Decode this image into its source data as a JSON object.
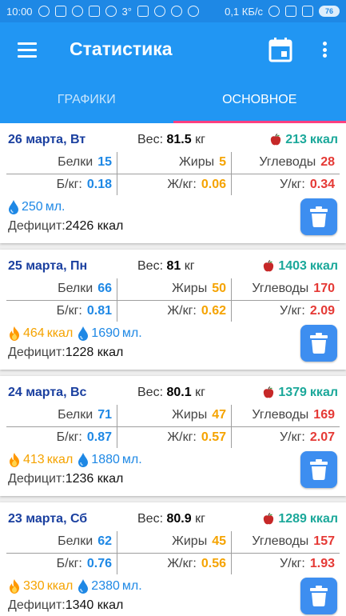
{
  "status_bar": {
    "time": "10:00",
    "temperature": "3°",
    "net_speed": "0,1 КБ/с",
    "battery": "76"
  },
  "app_bar": {
    "title": "Статистика",
    "menu_icon": "menu-icon",
    "calendar_icon": "calendar-icon",
    "more_icon": "more-vert-icon"
  },
  "tabs": [
    {
      "label": "ГРАФИКИ",
      "active": false
    },
    {
      "label": "ОСНОВНОЕ",
      "active": true
    }
  ],
  "labels": {
    "weight": "Вес:",
    "kg": "кг",
    "kcal": "ккал",
    "protein": "Белки",
    "fat": "Жиры",
    "carbs": "Углеводы",
    "protein_per_kg": "Б/кг:",
    "fat_per_kg": "Ж/кг:",
    "carbs_per_kg": "У/кг:",
    "ml": "мл.",
    "deficit": "Дефицит:"
  },
  "colors": {
    "primary": "#2196f3",
    "tab_indicator": "#ff4081",
    "date": "#1a3f9f",
    "kcal_green": "#1ba89a",
    "protein_blue": "#1e88e5",
    "fat_orange": "#f5a300",
    "carbs_red": "#e53935",
    "trash_button": "#3d8ef0"
  },
  "days": [
    {
      "date": "26 марта, Вт",
      "weight": "81.5",
      "kcal": "213",
      "protein": "15",
      "fat": "5",
      "carbs": "28",
      "protein_per_kg": "0.18",
      "fat_per_kg": "0.06",
      "carbs_per_kg": "0.34",
      "burned": "",
      "water": "250",
      "deficit": "2426 ккал"
    },
    {
      "date": "25 марта, Пн",
      "weight": "81",
      "kcal": "1403",
      "protein": "66",
      "fat": "50",
      "carbs": "170",
      "protein_per_kg": "0.81",
      "fat_per_kg": "0.62",
      "carbs_per_kg": "2.09",
      "burned": "464",
      "water": "1690",
      "deficit": "1228 ккал"
    },
    {
      "date": "24 марта, Вс",
      "weight": "80.1",
      "kcal": "1379",
      "protein": "71",
      "fat": "47",
      "carbs": "169",
      "protein_per_kg": "0.87",
      "fat_per_kg": "0.57",
      "carbs_per_kg": "2.07",
      "burned": "413",
      "water": "1880",
      "deficit": "1236 ккал"
    },
    {
      "date": "23 марта, Сб",
      "weight": "80.9",
      "kcal": "1289",
      "protein": "62",
      "fat": "45",
      "carbs": "157",
      "protein_per_kg": "0.76",
      "fat_per_kg": "0.56",
      "carbs_per_kg": "1.93",
      "burned": "330",
      "water": "2380",
      "deficit": "1340 ккал"
    }
  ]
}
